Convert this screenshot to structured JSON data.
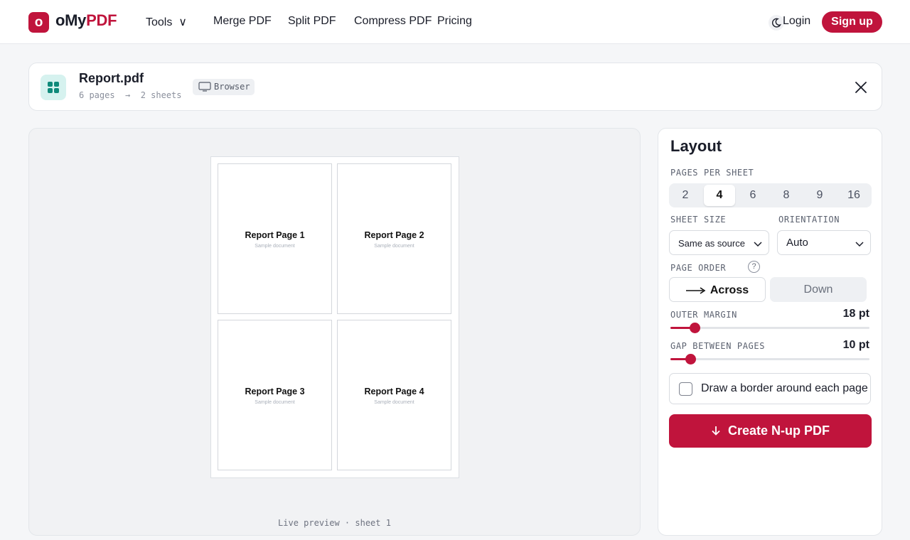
{
  "brand": {
    "mark": "o",
    "name_plain": "oMy",
    "name_accent": "PDF",
    "accent_color": "#c0143c"
  },
  "nav": {
    "tools": "Tools  ∨",
    "merge": "Merge PDF",
    "split": "Split PDF",
    "compress": "Compress PDF",
    "pricing": "Pricing"
  },
  "header_actions": {
    "theme_icon": "moon-icon",
    "login": "Login",
    "signup": "Sign up"
  },
  "file": {
    "name": "Report.pdf",
    "meta": "6 pages  →  2 sheets",
    "env": "Browser",
    "icon": "grid-icon"
  },
  "preview": {
    "pages": [
      {
        "title": "Report Page 1",
        "subtitle": "Sample document"
      },
      {
        "title": "Report Page 2",
        "subtitle": "Sample document"
      },
      {
        "title": "Report Page 3",
        "subtitle": "Sample document"
      },
      {
        "title": "Report Page 4",
        "subtitle": "Sample document"
      }
    ],
    "caption": "Live preview · sheet 1"
  },
  "layout": {
    "title": "Layout",
    "pages_per_sheet": {
      "label": "PAGES PER SHEET",
      "options": [
        "2",
        "4",
        "6",
        "8",
        "9",
        "16"
      ],
      "selected": "4"
    },
    "sheet_size": {
      "label": "SHEET SIZE",
      "value": "Same as source"
    },
    "orientation": {
      "label": "ORIENTATION",
      "value": "Auto"
    },
    "page_order": {
      "label": "PAGE ORDER",
      "help": "?",
      "options": [
        "Across",
        "Down"
      ],
      "selected": "Across"
    },
    "outer_margin": {
      "label": "OUTER MARGIN",
      "display": "18 pt",
      "fraction": 0.12
    },
    "gap": {
      "label": "GAP BETWEEN PAGES",
      "display": "10 pt",
      "fraction": 0.1
    },
    "border_checkbox": {
      "label": "Draw a border around each page",
      "checked": false
    },
    "cta": "Create N-up PDF"
  }
}
